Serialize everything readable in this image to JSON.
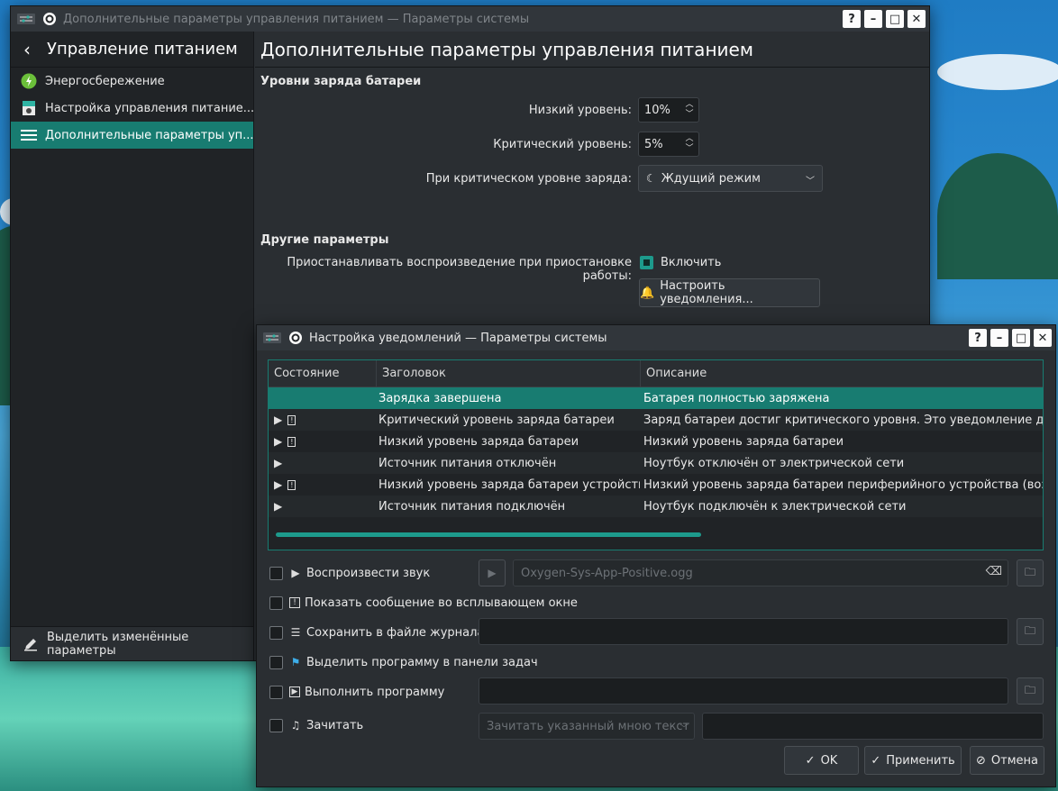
{
  "main_window": {
    "title": "Дополнительные параметры управления питанием — Параметры системы",
    "help_label": "?",
    "minimize_label": "–",
    "maximize_label": "□",
    "close_label": "✕",
    "sidebar": {
      "header": "Управление питанием",
      "items": [
        {
          "label": "Энергосбережение",
          "icon": "power-saving-icon"
        },
        {
          "label": "Настройка управления питание...",
          "icon": "power-profile-icon"
        },
        {
          "label": "Дополнительные параметры уп...",
          "icon": "hamburger-menu-icon",
          "active": true
        }
      ],
      "footer": "Выделить изменённые параметры"
    },
    "page_title": "Дополнительные параметры управления питанием",
    "battery_section": {
      "heading": "Уровни заряда батареи",
      "low_label": "Низкий уровень:",
      "low_value": "10%",
      "critical_label": "Критический уровень:",
      "critical_value": "5%",
      "action_label": "При критическом уровне заряда:",
      "action_value": "Ждущий режим"
    },
    "other_section": {
      "heading": "Другие параметры",
      "pause_label": "Приостанавливать воспроизведение при приостановке работы:",
      "pause_checkbox": "Включить",
      "pause_checked": true,
      "notify_button": "Настроить уведомления..."
    }
  },
  "notify_window": {
    "title": "Настройка уведомлений — Параметры системы",
    "help_label": "?",
    "minimize_label": "–",
    "maximize_label": "□",
    "close_label": "✕",
    "columns": [
      "Состояние",
      "Заголовок",
      "Описание"
    ],
    "rows": [
      {
        "play": false,
        "popup": false,
        "title": "Зарядка завершена",
        "description": "Батарея полностью заряжена",
        "selected": true
      },
      {
        "play": true,
        "popup": true,
        "title": "Критический уровень заряда батареи",
        "description": "Заряд батареи достиг критического уровня. Это уведомление добавл"
      },
      {
        "play": true,
        "popup": true,
        "title": "Низкий уровень заряда батареи",
        "description": "Низкий уровень заряда батареи"
      },
      {
        "play": true,
        "popup": false,
        "title": "Источник питания отключён",
        "description": "Ноутбук отключён от электрической сети"
      },
      {
        "play": true,
        "popup": true,
        "title": "Низкий уровень заряда батареи устройства",
        "description": "Низкий уровень заряда батареи периферийного устройства (возмож"
      },
      {
        "play": true,
        "popup": false,
        "title": "Источник питания подключён",
        "description": "Ноутбук подключён к электрической сети"
      }
    ],
    "options": {
      "play_sound": {
        "label": "Воспроизвести звук",
        "file": "Oxygen-Sys-App-Positive.ogg"
      },
      "show_popup": {
        "label": "Показать сообщение во всплывающем окне"
      },
      "log_file": {
        "label": "Сохранить в файле журнала"
      },
      "mark_taskbar": {
        "label": "Выделить программу в панели задач"
      },
      "run_command": {
        "label": "Выполнить программу"
      },
      "speech": {
        "label": "Зачитать",
        "mode": "Зачитать указанный мною текст"
      }
    },
    "buttons": {
      "ok": "OK",
      "apply": "Применить",
      "cancel": "Отмена"
    },
    "accent_color": "#187c71"
  }
}
